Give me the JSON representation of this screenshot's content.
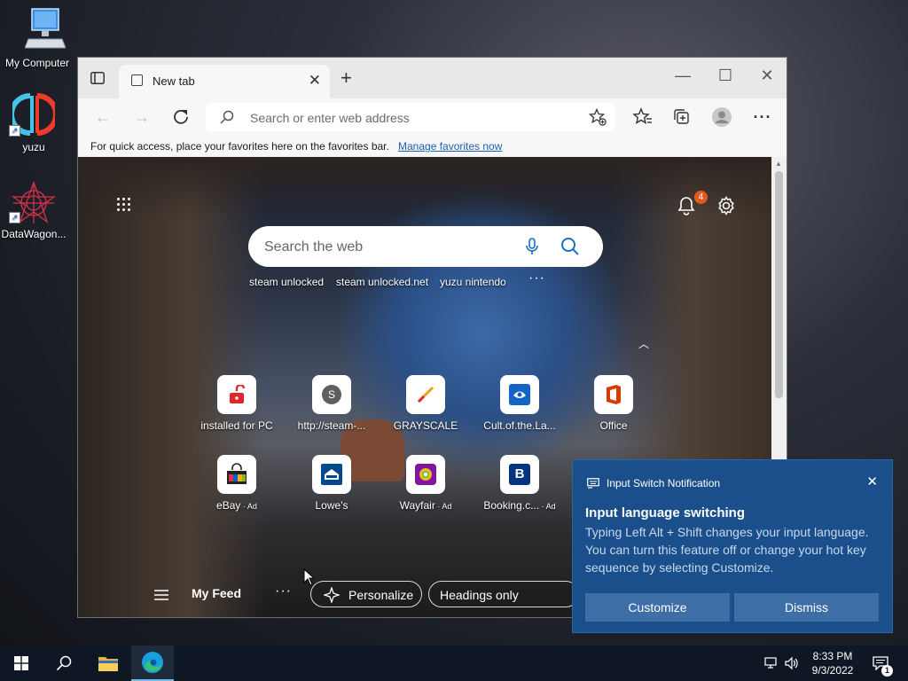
{
  "desktop": {
    "icons": [
      {
        "label": "My Computer"
      },
      {
        "label": "yuzu"
      },
      {
        "label": "DataWagon..."
      }
    ]
  },
  "browser": {
    "tab_title": "New tab",
    "address_placeholder": "Search or enter web address",
    "favorites_bar_message": "For quick access, place your favorites here on the favorites bar.",
    "favorites_bar_link": "Manage favorites now"
  },
  "newtab": {
    "notification_count": "4",
    "search_placeholder": "Search the web",
    "trending": [
      "steam unlocked",
      "steam unlocked.net",
      "yuzu nintendo"
    ],
    "top_sites": [
      {
        "label": "installed for PC",
        "ad": ""
      },
      {
        "label": "http://steam-...",
        "ad": "",
        "letter": "S"
      },
      {
        "label": "GRAYSCALE",
        "ad": ""
      },
      {
        "label": "Cult.of.the.La...",
        "ad": ""
      },
      {
        "label": "Office",
        "ad": ""
      },
      {
        "label": "eBay",
        "ad": "Ad"
      },
      {
        "label": "Lowe's",
        "ad": ""
      },
      {
        "label": "Wayfair",
        "ad": "Ad"
      },
      {
        "label": "Booking.c...",
        "ad": "Ad",
        "letter": "B"
      }
    ],
    "ad_separator": " · ",
    "feed": {
      "title": "My Feed",
      "personalize_label": "Personalize",
      "headings_label": "Headings only"
    }
  },
  "notification": {
    "app_name": "Input Switch Notification",
    "title": "Input language switching",
    "body": "Typing Left Alt + Shift changes your input language. You can turn this feature off or change your hot key sequence by selecting Customize.",
    "customize_label": "Customize",
    "dismiss_label": "Dismiss"
  },
  "taskbar": {
    "time": "8:33 PM",
    "date": "9/3/2022",
    "action_center_count": "1"
  },
  "colors": {
    "notification_bg": "#1a4f8b",
    "notification_button": "#3d6ea6",
    "taskbar_bg": "#0f1724",
    "badge": "#e35a1c",
    "link": "#1a5fb4"
  }
}
